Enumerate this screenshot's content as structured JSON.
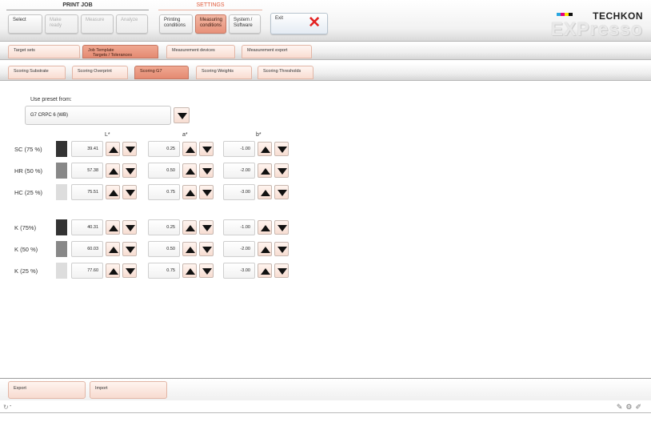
{
  "toolbar": {
    "groups": {
      "print_job": "PRINT JOB",
      "settings": "SETTINGS"
    },
    "buttons": {
      "select": "Select",
      "make_ready": "Make ready",
      "measure": "Measure",
      "analyze": "Analyze",
      "printing_conditions": [
        "Printing",
        "conditions"
      ],
      "measuring_conditions": [
        "Measuring",
        "conditions"
      ],
      "system_software": [
        "System /",
        "Software"
      ],
      "exit": "Exit"
    },
    "logo": {
      "brand": "TECHKON",
      "product": "EXPresso"
    }
  },
  "tabs_row1": {
    "target_sets": "Target sets",
    "job_template": [
      "Job Template",
      "Targets / Tolerances"
    ],
    "measurement_devices": "Measurement devices",
    "measurement_export": "Measurement export"
  },
  "tabs_row2": {
    "scoring_substrate": "Scoring Substrate",
    "scoring_overprint": "Scoring Overprint",
    "scoring_g7": "Scoring G7",
    "scoring_weights": "Scoring Weights",
    "scoring_thresholds": "Scoring Thresholds"
  },
  "preset": {
    "label": "Use preset from:",
    "value": "G7 CRPC 6 (WB)"
  },
  "columns": {
    "l": "L*",
    "a": "a*",
    "b": "b*"
  },
  "rows": [
    {
      "label": "SC (75 %)",
      "swatch": "#333333",
      "l": "39.41",
      "a": "0.25",
      "b": "-1.00"
    },
    {
      "label": "HR (50 %)",
      "swatch": "#888888",
      "l": "57.38",
      "a": "0.50",
      "b": "-2.00"
    },
    {
      "label": "HC (25 %)",
      "swatch": "#dddddd",
      "l": "75.51",
      "a": "0.75",
      "b": "-3.00"
    },
    {
      "label": "K (75%)",
      "swatch": "#333333",
      "l": "40.31",
      "a": "0.25",
      "b": "-1.00"
    },
    {
      "label": "K (50 %)",
      "swatch": "#888888",
      "l": "60.03",
      "a": "0.50",
      "b": "-2.00"
    },
    {
      "label": "K (25 %)",
      "swatch": "#dddddd",
      "l": "77.60",
      "a": "0.75",
      "b": "-3.00"
    }
  ],
  "bottom": {
    "export": "Export",
    "import": "Import"
  },
  "status": {
    "text": "-"
  },
  "colors": {
    "accent": "#e48a72",
    "tab_bg": "#f8dcd1",
    "exit_x": "#e32222"
  }
}
